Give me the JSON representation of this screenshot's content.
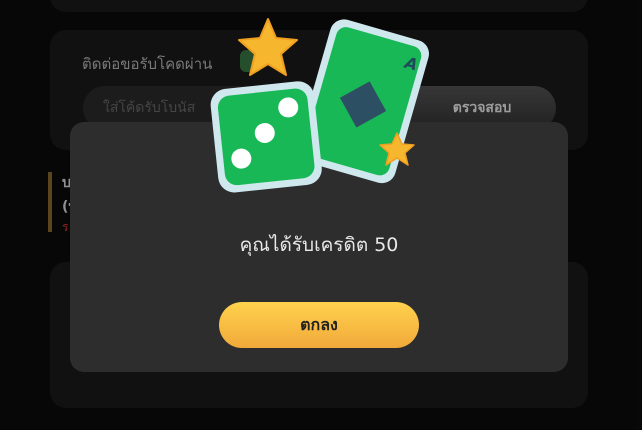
{
  "promo": {
    "contact_label": "ติดต่อขอรับโคดผ่าน",
    "code_placeholder": "ใส่โค้ดรับโบนัส",
    "check_button": "ตรวจสอบ"
  },
  "notice": {
    "line1": "บ",
    "line2": "(บ",
    "line3": "ร"
  },
  "modal": {
    "message": "คุณได้รับเครดิต 50",
    "ok_button": "ตกลง"
  },
  "art": {
    "card_letter": "A",
    "icons": [
      "dice-icon",
      "playing-card-icon",
      "star-icon"
    ]
  },
  "colors": {
    "background": "#0c0c0c",
    "panel": "#1b1b1b",
    "modal": "#2d2d2d",
    "accent_gold": "#ffd24d",
    "accent_green": "#18b857"
  }
}
